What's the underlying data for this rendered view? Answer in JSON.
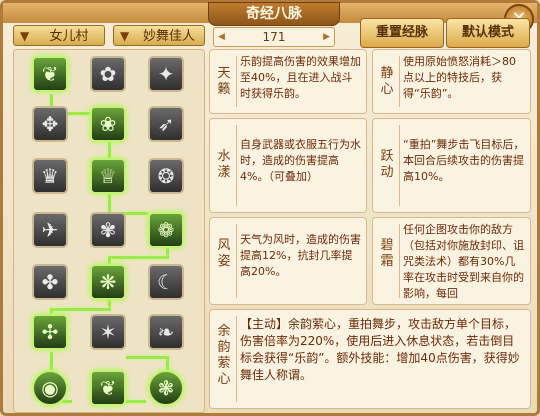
{
  "window": {
    "title": "奇经八脉",
    "close_label": "✕"
  },
  "filters": {
    "school": "女儿村",
    "skill_set": "妙舞佳人",
    "points": "171"
  },
  "buttons": {
    "reset": "重置经脉",
    "default": "默认模式"
  },
  "skills": [
    {
      "name": "天籁",
      "desc": "乐韵提高伤害的效果增加至40%，且在进入战斗时获得乐韵。"
    },
    {
      "name": "静心",
      "desc": "使用原始愤怒消耗＞80点以上的特技后，获得“乐韵”。"
    },
    {
      "name": "水漾",
      "desc": "自身武器或衣服五行为水时，造成的伤害提高4%。（可叠加）"
    },
    {
      "name": "跃动",
      "desc": "“重拍”舞步击飞目标后，本回合后续攻击的伤害提高10%。"
    },
    {
      "name": "风姿",
      "desc": "天气为风时，造成的伤害提高12%，抗封几率提高20%。"
    },
    {
      "name": "碧霜",
      "desc": "任何企图攻击你的敌方（包括对你施放封印、诅咒类法术）都有30%几率在攻击时受到来自你的影响，每回"
    },
    {
      "name": "余韵萦心",
      "desc": "【主动】余韵萦心，重拍舞步，攻击敌方单个目标，伤害倍率为220%，使用后进入休息状态，若击倒目标会获得“乐韵”。额外技能：增加40点伤害，获得妙舞佳人称谓。"
    }
  ],
  "tree_icons": [
    "wing-icon",
    "sprout-icon",
    "shuriken-icon",
    "paw-icon",
    "lotus-icon",
    "feather-icon",
    "dancer-icon",
    "crown-icon",
    "wave-icon",
    "bird-icon",
    "flower-icon",
    "swirl-icon",
    "rabbit-icon",
    "cloud-icon",
    "moon-icon",
    "pattern-icon",
    "star-icon",
    "vine-icon",
    "eye-icon",
    "leaf-icon",
    "knot-icon",
    "bloom-icon",
    "ring-icon",
    "fan-icon",
    "ring-icon"
  ]
}
